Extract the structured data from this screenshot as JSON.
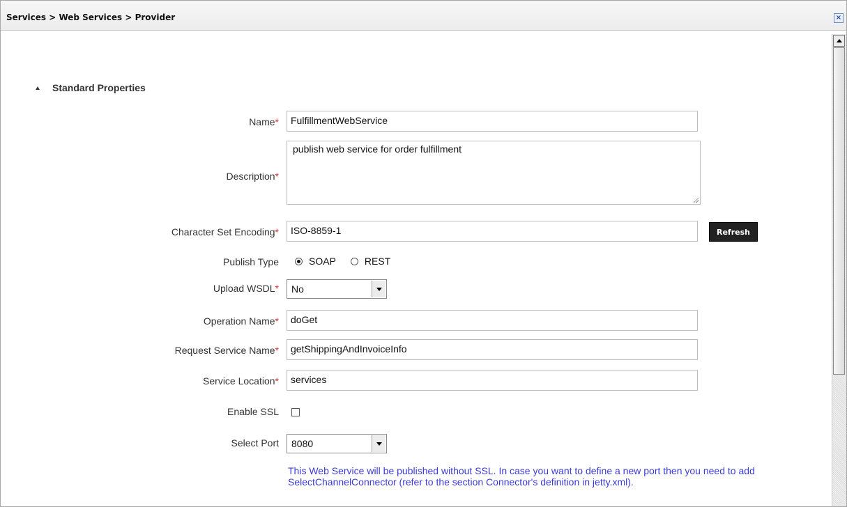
{
  "window": {
    "breadcrumb": "Services > Web Services > Provider",
    "close_glyph": "×"
  },
  "section": {
    "title": "Standard Properties"
  },
  "form": {
    "name_label": "Name",
    "name_value": "FulfillmentWebService",
    "description_label": "Description",
    "description_value": "publish web service for order fulfillment",
    "charset_label": "Character Set Encoding",
    "charset_value": "ISO-8859-1",
    "refresh_label": "Refresh",
    "publish_type_label": "Publish Type",
    "publish_type_options": [
      {
        "label": "SOAP",
        "selected": true
      },
      {
        "label": "REST",
        "selected": false
      }
    ],
    "upload_wsdl_label": "Upload WSDL",
    "upload_wsdl_value": "No",
    "operation_name_label": "Operation Name",
    "operation_name_value": "doGet",
    "request_service_label": "Request Service Name",
    "request_service_value": "getShippingAndInvoiceInfo",
    "service_location_label": "Service Location",
    "service_location_value": "services",
    "enable_ssl_label": "Enable SSL",
    "enable_ssl_checked": false,
    "select_port_label": "Select Port",
    "select_port_value": "8080",
    "info_message": "This Web Service will be published without SSL. In case you want to define a new port then you need to add SelectChannelConnector (refer to the section Connector's definition in jetty.xml).",
    "required_marker": "*"
  },
  "colors": {
    "required": "#e03030",
    "info_text": "#3a3ad6",
    "refresh_button_bg": "#222222"
  }
}
